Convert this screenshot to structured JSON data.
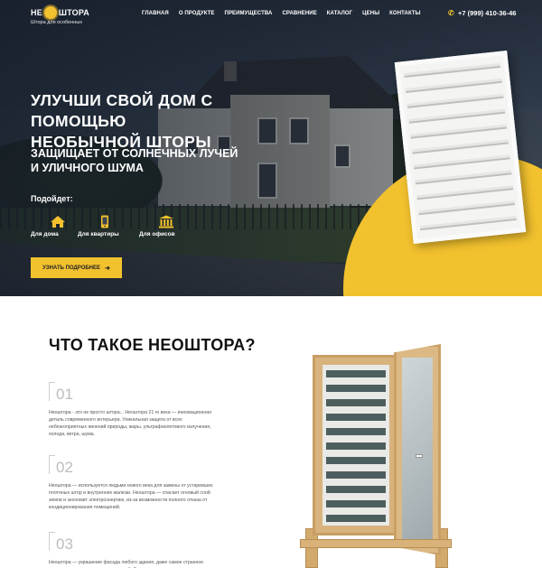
{
  "header": {
    "logo": {
      "left_word": "НЕ",
      "right_word": "ШТОРА",
      "tagline": "Штора для особенных"
    },
    "nav": [
      {
        "label": "ГЛАВНАЯ"
      },
      {
        "label": "О ПРОДУКТЕ"
      },
      {
        "label": "ПРЕИМУЩЕСТВА"
      },
      {
        "label": "СРАВНЕНИЕ"
      },
      {
        "label": "КАТАЛОГ"
      },
      {
        "label": "ЦЕНЫ"
      },
      {
        "label": "КОНТАКТЫ"
      }
    ],
    "phone": "+7 (999) 410-36-46",
    "phone_icon": "phone-icon"
  },
  "hero": {
    "title_line1": "УЛУЧШИ СВОЙ ДОМ С ПОМОЩЬЮ",
    "title_line2": "НЕОБЫЧНОЙ ШТОРЫ",
    "subtitle_line1": "ЗАЩИЩАЕТ ОТ СОЛНЕЧНЫХ ЛУЧЕЙ",
    "subtitle_line2": "И УЛИЧНОГО ШУМА",
    "suits_label": "Подойдет:",
    "features": [
      {
        "label": "Для дома",
        "icon": "house-icon"
      },
      {
        "label": "Для квартиры",
        "icon": "phone-device-icon"
      },
      {
        "label": "Для офисов",
        "icon": "building-icon"
      }
    ],
    "cta_label": "УЗНАТЬ ПОДРОБНЕЕ",
    "cta_icon": "arrow-right-icon",
    "accent_color": "#f2c12e"
  },
  "about": {
    "title": "ЧТО ТАКОЕ НЕОШТОРА?",
    "steps": [
      {
        "number": "01",
        "text": "Неоштора - это не просто штора... Неоштора 21 го века — инновационная деталь современного интерьера. Уникальная защита от всех неблагоприятных явлений природы, жары, ультрафиолетового излучения, холода, ветра, шума."
      },
      {
        "number": "02",
        "text": "Неоштора — используется людьми нового века для замены от устаревших плотяных штор и внутренних жалюзи. Неоштора — спасает огновый слой земли и экономит электроэнергию, из-за возможности полного отказа от кондиционирования помещений."
      },
      {
        "number": "03",
        "text": "Неоштора — украшение фасада любого здания, даже самое странное строение смотрится намного веселей. За счет"
      }
    ]
  }
}
